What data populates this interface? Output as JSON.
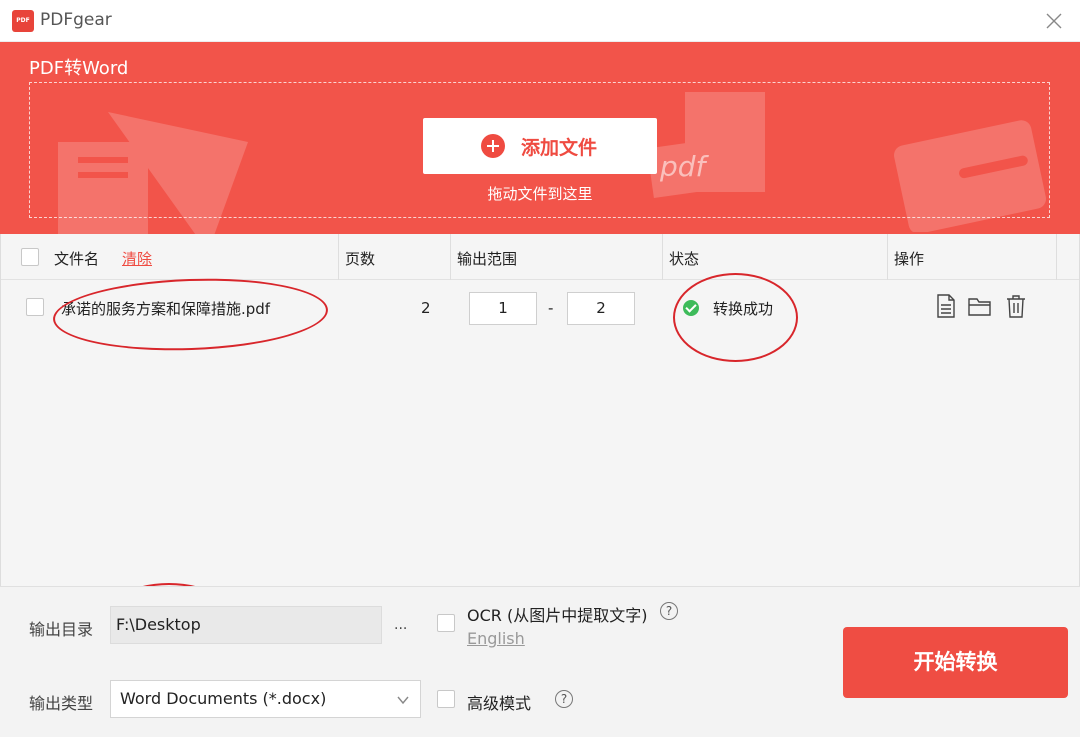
{
  "app": {
    "title": "PDFgear",
    "logo_text": "PDF"
  },
  "header": {
    "title": "PDF转Word",
    "add_button_label": "添加文件",
    "drag_hint": "拖动文件到这里",
    "deco_text": "pdf"
  },
  "table": {
    "columns": {
      "filename": "文件名",
      "clear": "清除",
      "pages": "页数",
      "range": "输出范围",
      "status": "状态",
      "actions": "操作"
    },
    "rows": [
      {
        "filename": "承诺的服务方案和保障措施.pdf",
        "pages": "2",
        "range_from": "1",
        "range_sep": "-",
        "range_to": "2",
        "status": "转换成功"
      }
    ]
  },
  "output": {
    "dir_label": "输出目录",
    "dir_value": "F:\\Desktop",
    "browse": "...",
    "type_label": "输出类型",
    "type_value": "Word Documents (*.docx)"
  },
  "options": {
    "ocr_label": "OCR (从图片中提取文字)",
    "ocr_language": "English",
    "advanced_label": "高级模式",
    "help": "?"
  },
  "start_button": "开始转换",
  "colors": {
    "accent": "#ef4b41",
    "success": "#3dbb5a",
    "annotation": "#d8262b"
  },
  "icons": [
    "close-icon",
    "plus-icon",
    "success-check-icon",
    "document-icon",
    "folder-icon",
    "trash-icon",
    "chevron-down-icon",
    "help-icon"
  ]
}
